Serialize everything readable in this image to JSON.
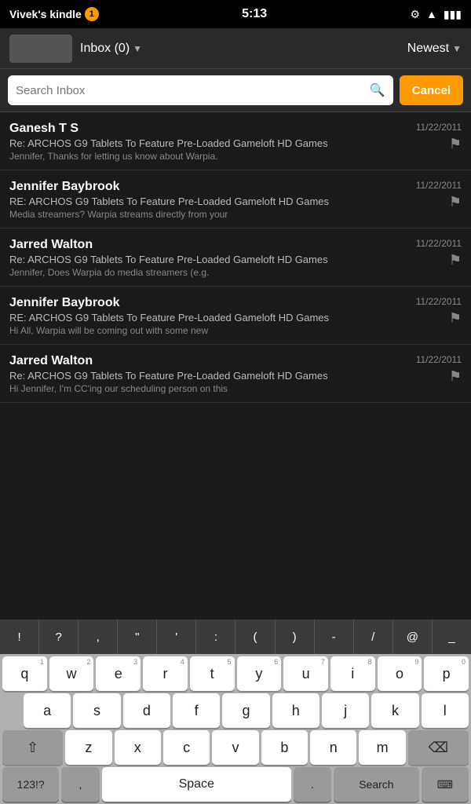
{
  "status_bar": {
    "app_name": "Vivek's kindle",
    "notification_count": "1",
    "time": "5:13"
  },
  "top_bar": {
    "inbox_label": "Inbox (0)",
    "newest_label": "Newest"
  },
  "search": {
    "placeholder": "Search Inbox",
    "cancel_label": "Cancel"
  },
  "emails": [
    {
      "sender": "Ganesh T S",
      "subject": "Re: ARCHOS G9 Tablets To Feature Pre-Loaded Gameloft HD Games",
      "preview": "Jennifer, Thanks for letting us know about Warpia.",
      "date": "11/22/2011"
    },
    {
      "sender": "Jennifer Baybrook",
      "subject": "RE: ARCHOS G9 Tablets To Feature Pre-Loaded Gameloft HD Games",
      "preview": "Media streamers? Warpia streams directly from your",
      "date": "11/22/2011"
    },
    {
      "sender": "Jarred Walton",
      "subject": "Re: ARCHOS G9 Tablets To Feature Pre-Loaded Gameloft HD Games",
      "preview": "Jennifer, Does Warpia do media streamers (e.g.",
      "date": "11/22/2011"
    },
    {
      "sender": "Jennifer Baybrook",
      "subject": "RE: ARCHOS G9 Tablets To Feature Pre-Loaded Gameloft HD Games",
      "preview": "Hi All, Warpia will be coming out with some new",
      "date": "11/22/2011"
    },
    {
      "sender": "Jarred Walton",
      "subject": "Re: ARCHOS G9 Tablets To Feature Pre-Loaded Gameloft HD Games",
      "preview": "Hi Jennifer, I'm CC'ing our scheduling person on this",
      "date": "11/22/2011"
    }
  ],
  "keyboard": {
    "special_keys": [
      "!",
      "?",
      ",",
      "\"",
      "'",
      ":",
      "(",
      ")",
      "-",
      "/",
      "@",
      "_"
    ],
    "row1": [
      {
        "label": "q",
        "num": "1"
      },
      {
        "label": "w",
        "num": "2"
      },
      {
        "label": "e",
        "num": "3"
      },
      {
        "label": "r",
        "num": "4"
      },
      {
        "label": "t",
        "num": "5"
      },
      {
        "label": "y",
        "num": "6"
      },
      {
        "label": "u",
        "num": "7"
      },
      {
        "label": "i",
        "num": "8"
      },
      {
        "label": "o",
        "num": "9"
      },
      {
        "label": "p",
        "num": "0"
      }
    ],
    "row2": [
      {
        "label": "a"
      },
      {
        "label": "s"
      },
      {
        "label": "d"
      },
      {
        "label": "f"
      },
      {
        "label": "g"
      },
      {
        "label": "h"
      },
      {
        "label": "j"
      },
      {
        "label": "k"
      },
      {
        "label": "l"
      }
    ],
    "row3": [
      {
        "label": "z"
      },
      {
        "label": "x"
      },
      {
        "label": "c"
      },
      {
        "label": "v"
      },
      {
        "label": "b"
      },
      {
        "label": "n"
      },
      {
        "label": "m"
      }
    ],
    "bottom": {
      "sym": "123!?",
      "comma": ",",
      "space": "Space",
      "period": ".",
      "search": "Search"
    }
  }
}
